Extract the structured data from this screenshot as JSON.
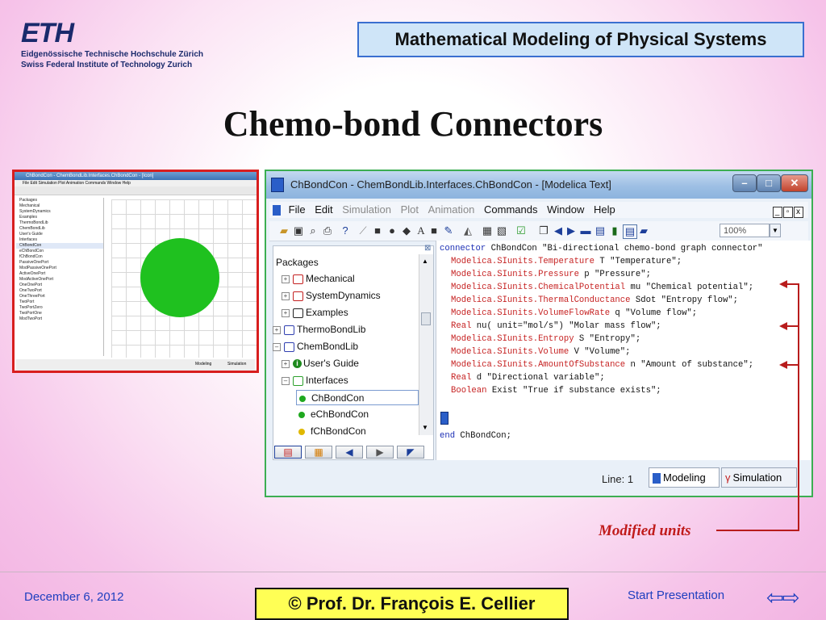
{
  "header": {
    "logo_word": "ETH",
    "logo_line1": "Eidgenössische Technische Hochschule Zürich",
    "logo_line2": "Swiss Federal Institute of Technology Zurich",
    "course_title": "Mathematical Modeling of Physical Systems"
  },
  "slide_title": "Chemo-bond Connectors",
  "thumbnail": {
    "title": "ChBondCon - ChemBondLib.Interfaces.ChBondCon - [Icon]",
    "menu": "File Edit Simulation Plot Animation Commands Window Help",
    "tree": [
      "Packages",
      "Mechanical",
      "SystemDynamics",
      "Examples",
      "ThermoBondLib",
      "ChemBondLib",
      "User's Guide",
      "Interfaces",
      "ChBondCon",
      "eChBondCon",
      "fChBondCon",
      "PassiveOnePort",
      "ModPassiveOnePort",
      "ActiveOnePort",
      "ModActiveOnePort",
      "OneOnePort",
      "OneTwoPort",
      "OneThreePort",
      "TwoPort",
      "TwoPortZero",
      "TwoPortOne",
      "ModTwoPort"
    ],
    "tab_modeling": "Modeling",
    "tab_simulation": "Simulation",
    "circle_color": "#1fc11f"
  },
  "window": {
    "title": "ChBondCon - ChemBondLib.Interfaces.ChBondCon  - [Modelica Text]",
    "menu": [
      {
        "label": "File",
        "enabled": true
      },
      {
        "label": "Edit",
        "enabled": true
      },
      {
        "label": "Simulation",
        "enabled": false
      },
      {
        "label": "Plot",
        "enabled": false
      },
      {
        "label": "Animation",
        "enabled": false
      },
      {
        "label": "Commands",
        "enabled": true
      },
      {
        "label": "Window",
        "enabled": true
      },
      {
        "label": "Help",
        "enabled": true
      }
    ],
    "zoom": "100%",
    "packages_label": "Packages",
    "tree": {
      "mechanical": "Mechanical",
      "system_dynamics": "SystemDynamics",
      "examples": "Examples",
      "thermo": "ThermoBondLib",
      "chem": "ChemBondLib",
      "users_guide": "User's Guide",
      "interfaces": "Interfaces",
      "chbondcon": "ChBondCon",
      "echbondcon": "eChBondCon",
      "fchbondcon": "fChBondCon"
    },
    "code": {
      "l1_kw": "connector",
      "l1_rest": " ChBondCon \"Bi-directional chemo-bond graph connector\"",
      "l2_ty": "Modelica.SIunits.Temperature",
      "l2_rest": " T \"Temperature\";",
      "l3_ty": "Modelica.SIunits.Pressure",
      "l3_rest": " p \"Pressure\";",
      "l4_ty": "Modelica.SIunits.ChemicalPotential",
      "l4_rest": " mu \"Chemical potential\";",
      "l5_ty": "Modelica.SIunits.ThermalConductance",
      "l5_rest": " Sdot \"Entropy flow\";",
      "l6_ty": "Modelica.SIunits.VolumeFlowRate",
      "l6_rest": " q \"Volume flow\";",
      "l7_ty": "Real",
      "l7_rest": " nu( unit=\"mol/s\") \"Molar mass flow\";",
      "l8_ty": "Modelica.SIunits.Entropy",
      "l8_rest": " S \"Entropy\";",
      "l9_ty": "Modelica.SIunits.Volume",
      "l9_rest": " V \"Volume\";",
      "l10_ty": "Modelica.SIunits.AmountOfSubstance",
      "l10_rest": " n \"Amount of substance\";",
      "l11_ty": "Real",
      "l11_rest": " d \"Directional variable\";",
      "l12_ty": "Boolean",
      "l12_rest": " Exist \"True if substance exists\";",
      "end_kw": "end",
      "end_rest": " ChBondCon;"
    },
    "status": {
      "line_label": "Line:",
      "line_value": "1",
      "tab_modeling": "Modeling",
      "tab_simulation": "Simulation"
    }
  },
  "annotation": {
    "text": "Modified units",
    "color": "#c01b1b"
  },
  "footer": {
    "date": "December 6, 2012",
    "author": "©  Prof. Dr. François E. Cellier",
    "start": "Start Presentation"
  }
}
